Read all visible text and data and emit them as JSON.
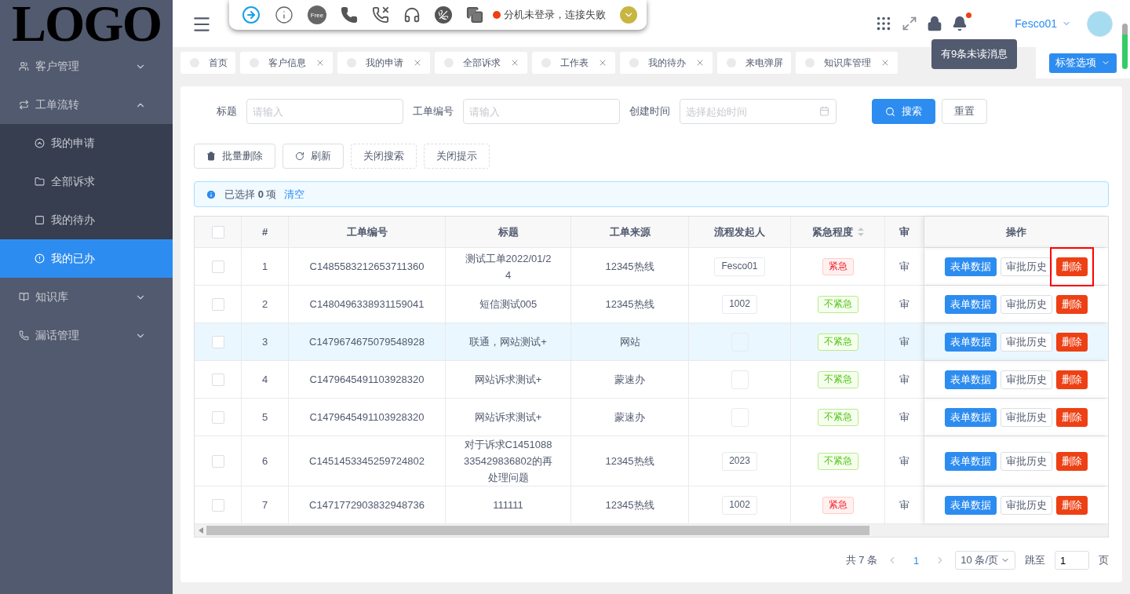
{
  "logo": "LOGO",
  "sidebar": {
    "items": [
      {
        "label": "客户管理",
        "expanded": false,
        "selected": false
      },
      {
        "label": "工单流转",
        "expanded": true,
        "selected": false,
        "children": [
          {
            "label": "我的申请",
            "selected": false
          },
          {
            "label": "全部诉求",
            "selected": false
          },
          {
            "label": "我的待办",
            "selected": false
          },
          {
            "label": "我的已办",
            "selected": true
          }
        ]
      },
      {
        "label": "知识库",
        "expanded": false,
        "selected": false
      },
      {
        "label": "漏话管理",
        "expanded": false,
        "selected": false
      }
    ]
  },
  "phone_bar": {
    "free_badge": "Free",
    "status": "分机未登录，连接失败",
    "connected": false
  },
  "header": {
    "user": "Fesco01",
    "unread": true,
    "tooltip": "有9条未读消息"
  },
  "tabs": [
    {
      "label": "首页",
      "closable": false,
      "selected": false
    },
    {
      "label": "客户信息",
      "closable": true,
      "selected": false
    },
    {
      "label": "我的申请",
      "closable": true,
      "selected": false
    },
    {
      "label": "全部诉求",
      "closable": true,
      "selected": false
    },
    {
      "label": "工作表",
      "closable": true,
      "selected": false
    },
    {
      "label": "我的待办",
      "closable": true,
      "selected": false
    },
    {
      "label": "来电弹屏",
      "closable": false,
      "selected": false
    },
    {
      "label": "知识库管理",
      "closable": true,
      "selected": false
    }
  ],
  "tab_options": "标签选项",
  "search": {
    "fields": [
      {
        "label": "标题",
        "placeholder": "请输入",
        "kind": "text"
      },
      {
        "label": "工单编号",
        "placeholder": "请输入",
        "kind": "text"
      },
      {
        "label": "创建时间",
        "placeholder": "选择起始时间",
        "kind": "date"
      }
    ],
    "search_button": "搜索",
    "reset_button": "重置"
  },
  "toolbar": [
    {
      "label": "批量删除",
      "kind": "delete"
    },
    {
      "label": "刷新",
      "kind": "refresh"
    },
    {
      "label": "关闭搜索",
      "kind": "dashed"
    },
    {
      "label": "关闭提示",
      "kind": "dashed"
    }
  ],
  "alert": {
    "text": "已选择 **0** 项",
    "link": "清空"
  },
  "table": {
    "all_checked": false,
    "columns": [
      "#",
      "工单编号",
      "标题",
      "工单来源",
      "流程发起人",
      "紧急程度",
      "审",
      "操作"
    ],
    "rows": [
      {
        "index": "1",
        "number": "C1485583212653711360",
        "title": "测试工单2022/01/24",
        "source": "12345热线",
        "initiator": "Fesco01",
        "urgency": "紧急",
        "urgent": true,
        "column_7": "审",
        "checked": false,
        "hover": false,
        "delete_marked": true,
        "actions": [
          {
            "label": "表单数据",
            "kind": "primary"
          },
          {
            "label": "审批历史",
            "kind": "default"
          },
          {
            "label": "删除",
            "kind": "danger"
          }
        ]
      },
      {
        "index": "2",
        "number": "C1480496338931159041",
        "title": "短信测试005",
        "source": "12345热线",
        "initiator": "1002",
        "urgency": "不紧急",
        "urgent": false,
        "column_7": "审",
        "checked": false,
        "hover": false,
        "delete_marked": false,
        "actions": [
          {
            "label": "表单数据",
            "kind": "primary"
          },
          {
            "label": "审批历史",
            "kind": "default"
          },
          {
            "label": "删除",
            "kind": "danger"
          }
        ]
      },
      {
        "index": "3",
        "number": "C1479674675079548928",
        "title": "联通，网站测试+",
        "source": "网站",
        "urgency": "不紧急",
        "urgent": false,
        "column_7": "审",
        "checked": false,
        "hover": true,
        "delete_marked": false,
        "actions": [
          {
            "label": "表单数据",
            "kind": "primary"
          },
          {
            "label": "审批历史",
            "kind": "default"
          },
          {
            "label": "删除",
            "kind": "danger"
          }
        ]
      },
      {
        "index": "4",
        "number": "C1479645491103928320",
        "title": "网站诉求测试+",
        "source": "蒙速办",
        "urgency": "不紧急",
        "urgent": false,
        "column_7": "审",
        "checked": false,
        "hover": false,
        "delete_marked": false,
        "actions": [
          {
            "label": "表单数据",
            "kind": "primary"
          },
          {
            "label": "审批历史",
            "kind": "default"
          },
          {
            "label": "删除",
            "kind": "danger"
          }
        ]
      },
      {
        "index": "5",
        "number": "C1479645491103928320",
        "title": "网站诉求测试+",
        "source": "蒙速办",
        "urgency": "不紧急",
        "urgent": false,
        "column_7": "审",
        "checked": false,
        "hover": false,
        "delete_marked": false,
        "actions": [
          {
            "label": "表单数据",
            "kind": "primary"
          },
          {
            "label": "审批历史",
            "kind": "default"
          },
          {
            "label": "删除",
            "kind": "danger"
          }
        ]
      },
      {
        "index": "6",
        "number": "C1451453345259724802",
        "title": "对于诉求C1451088335429836802的再处理问题",
        "source": "12345热线",
        "initiator": "2023",
        "urgency": "不紧急",
        "urgent": false,
        "column_7": "审",
        "checked": false,
        "hover": false,
        "delete_marked": false,
        "actions": [
          {
            "label": "表单数据",
            "kind": "primary"
          },
          {
            "label": "审批历史",
            "kind": "default"
          },
          {
            "label": "删除",
            "kind": "danger"
          }
        ]
      },
      {
        "index": "7",
        "number": "C1471772903832948736",
        "title": "111111",
        "source": "12345热线",
        "initiator": "1002",
        "urgency": "紧急",
        "urgent": true,
        "column_7": "审",
        "checked": false,
        "hover": false,
        "delete_marked": false,
        "actions": [
          {
            "label": "表单数据",
            "kind": "primary"
          },
          {
            "label": "审批历史",
            "kind": "default"
          },
          {
            "label": "删除",
            "kind": "danger"
          }
        ]
      }
    ]
  },
  "pagination": {
    "total": "共 7 条",
    "pages": [
      {
        "label": "1",
        "selected": true
      }
    ],
    "page_size": "10 条/页",
    "jump_label": "跳至",
    "jump_value": "1",
    "page_unit": "页"
  }
}
